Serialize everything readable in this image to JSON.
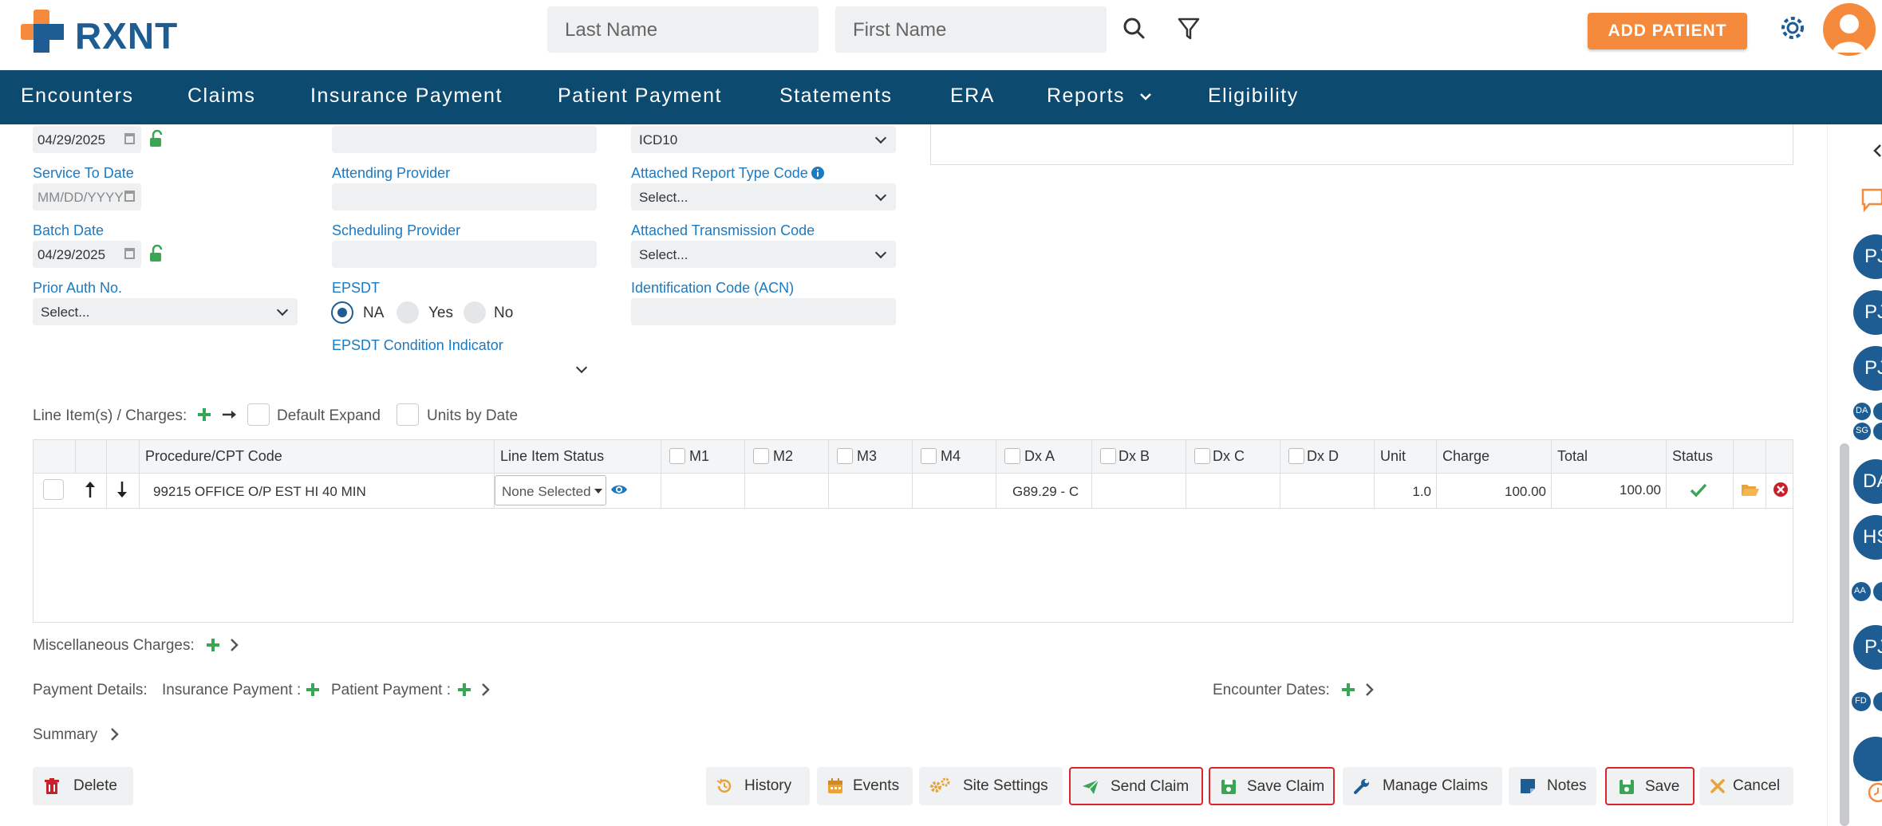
{
  "header": {
    "logo_text": "RXNT",
    "last_name_placeholder": "Last Name",
    "first_name_placeholder": "First Name",
    "add_patient_label": "ADD PATIENT"
  },
  "nav": {
    "items": [
      "Encounters",
      "Claims",
      "Insurance Payment",
      "Patient Payment",
      "Statements",
      "ERA",
      "Reports",
      "Eligibility"
    ]
  },
  "form": {
    "service_from_date": "04/29/2025",
    "service_to_label": "Service To Date",
    "service_to_placeholder": "MM/DD/YYYY",
    "batch_date_label": "Batch Date",
    "batch_date": "04/29/2025",
    "prior_auth_label": "Prior Auth No.",
    "prior_auth_value": "Select...",
    "attending_label": "Attending Provider",
    "scheduling_label": "Scheduling Provider",
    "epsdt_label": "EPSDT",
    "epsdt_options": [
      "NA",
      "Yes",
      "No"
    ],
    "epsdt_selected": "NA",
    "epsdt_condition_label": "EPSDT Condition Indicator",
    "icd_value": "ICD10",
    "report_type_label": "Attached Report Type Code",
    "report_type_value": "Select...",
    "transmission_label": "Attached Transmission Code",
    "transmission_value": "Select...",
    "acn_label": "Identification Code (ACN)"
  },
  "line_items": {
    "label": "Line Item(s) / Charges:",
    "default_expand_label": "Default Expand",
    "units_by_date_label": "Units by Date",
    "columns": [
      "Procedure/CPT Code",
      "Line Item Status",
      "M1",
      "M2",
      "M3",
      "M4",
      "Dx A",
      "Dx B",
      "Dx C",
      "Dx D",
      "Unit",
      "Charge",
      "Total",
      "Status"
    ],
    "rows": [
      {
        "procedure": "99215 OFFICE O/P EST HI 40 MIN",
        "status": "None Selected",
        "dx_a": "G89.29 - C",
        "unit": "1.0",
        "charge": "100.00",
        "total": "100.00"
      }
    ]
  },
  "misc_charges_label": "Miscellaneous Charges:",
  "payment_details": {
    "label": "Payment Details:",
    "insurance_label": "Insurance Payment :",
    "patient_label": "Patient Payment :",
    "encounter_dates_label": "Encounter Dates:"
  },
  "summary_label": "Summary",
  "footer": {
    "delete": "Delete",
    "history": "History",
    "events": "Events",
    "site_settings": "Site Settings",
    "send_claim": "Send Claim",
    "save_claim": "Save Claim",
    "manage_claims": "Manage Claims",
    "notes": "Notes",
    "save": "Save",
    "cancel": "Cancel"
  },
  "rail": {
    "bubbles": [
      "PJ",
      "PJ",
      "PJ",
      "DA",
      "SG",
      "DA",
      "HS",
      "AA",
      "PJ",
      "FD"
    ]
  },
  "colors": {
    "brand_blue": "#1d5d93",
    "nav_bg": "#0d4a70",
    "accent_orange": "#f58a3c",
    "link_blue": "#1b7ac0",
    "highlight_red": "#d9262c",
    "success_green": "#3aa655"
  }
}
